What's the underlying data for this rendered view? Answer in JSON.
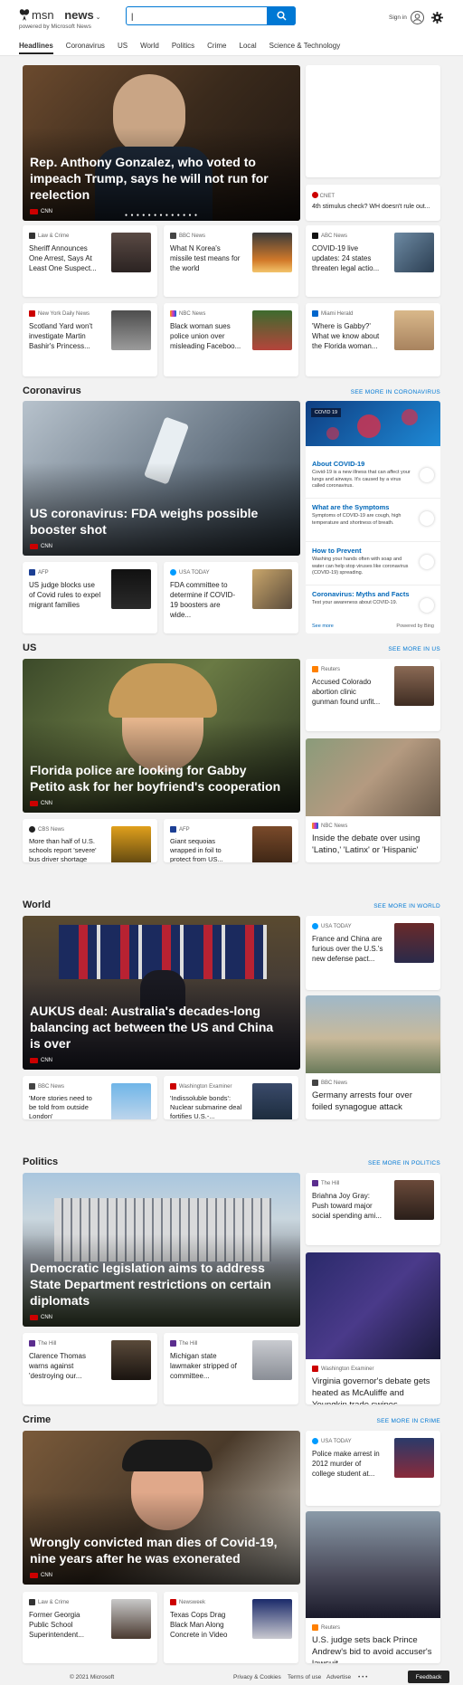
{
  "header": {
    "logo": "msn",
    "section": "news",
    "powered": "powered by Microsoft News",
    "search_value": "|",
    "signin": "Sign in"
  },
  "nav": [
    "Headlines",
    "Coronavirus",
    "US",
    "World",
    "Politics",
    "Crime",
    "Local",
    "Science & Technology"
  ],
  "top": {
    "hero": {
      "title": "Rep. Anthony Gonzalez, who voted to impeach Trump, says he will not run for reelection",
      "source": "CNN",
      "dots": "● ● ● ● ● ● ● ● ● ● ● ● ●"
    },
    "side": {
      "source": "CNET",
      "title": "4th stimulus check? WH doesn't rule out..."
    },
    "row1": [
      {
        "source": "Law & Crime",
        "title": "Sheriff Announces One Arrest, Says At Least One Suspect..."
      },
      {
        "source": "BBC News",
        "title": "What N Korea's missile test means for the world"
      },
      {
        "source": "ABC News",
        "title": "COVID-19 live updates: 24 states threaten legal actio..."
      }
    ],
    "row2": [
      {
        "source": "New York Daily News",
        "title": "Scotland Yard won't investigate Martin Bashir's Princess..."
      },
      {
        "source": "NBC News",
        "title": "Black woman sues police union over misleading Faceboo..."
      },
      {
        "source": "Miami Herald",
        "title": "'Where is Gabby?' What we know about the Florida woman..."
      }
    ]
  },
  "coronavirus": {
    "heading": "Coronavirus",
    "more": "SEE MORE IN CORONAVIRUS",
    "hero": {
      "title": "US coronavirus: FDA weighs possible booster shot",
      "source": "CNN"
    },
    "panel": {
      "badge": "COVID 19",
      "items": [
        {
          "title": "About COVID-19",
          "text": "Covid-19 is a new illness that can affect your lungs and airways. It's caused by a virus called coronavirus."
        },
        {
          "title": "What are the Symptoms",
          "text": "Symptoms of COVID-19 are cough, high temperature and shortness of breath."
        },
        {
          "title": "How to Prevent",
          "text": "Washing your hands often with soap and water can help stop viruses like coronavirus (COVID-19) spreading."
        },
        {
          "title": "Coronavirus: Myths and Facts",
          "text": "Test your awareness about COVID-19."
        }
      ],
      "see_more": "See more",
      "powered": "Powered by Bing"
    },
    "row": [
      {
        "source": "AFP",
        "title": "US judge blocks use of Covid rules to expel migrant families"
      },
      {
        "source": "USA TODAY",
        "title": "FDA committee to determine if COVID-19 boosters are wide..."
      }
    ]
  },
  "us": {
    "heading": "US",
    "more": "SEE MORE IN US",
    "hero": {
      "title": "Florida police are looking for Gabby Petito ask for her boyfriend's cooperation",
      "source": "CNN"
    },
    "side": {
      "source": "Reuters",
      "title": "Accused Colorado abortion clinic gunman found unfit..."
    },
    "big": {
      "source": "NBC News",
      "title": "Inside the debate over using 'Latino,' 'Latinx' or 'Hispanic'"
    },
    "row": [
      {
        "source": "CBS News",
        "title": "More than half of U.S. schools report 'severe' bus driver shortage"
      },
      {
        "source": "AFP",
        "title": "Giant sequoias wrapped in foil to protect from US..."
      }
    ]
  },
  "world": {
    "heading": "World",
    "more": "SEE MORE IN WORLD",
    "hero": {
      "title": "AUKUS deal: Australia's decades-long balancing act between the US and China is over",
      "source": "CNN"
    },
    "side": {
      "source": "USA TODAY",
      "title": "France and China are furious over the U.S.'s new defense pact..."
    },
    "big": {
      "source": "BBC News",
      "title": "Germany arrests four over foiled synagogue attack"
    },
    "row": [
      {
        "source": "BBC News",
        "title": "'More stories need to be told from outside London'"
      },
      {
        "source": "Washington Examiner",
        "title": "'Indissoluble bonds': Nuclear submarine deal fortifies U.S.-..."
      }
    ]
  },
  "politics": {
    "heading": "Politics",
    "more": "SEE MORE IN POLITICS",
    "hero": {
      "title": "Democratic legislation aims to address State Department restrictions on certain diplomats",
      "source": "CNN"
    },
    "side": {
      "source": "The Hill",
      "title": "Briahna Joy Gray: Push toward major social spending ami..."
    },
    "big": {
      "source": "Washington Examiner",
      "title": "Virginia governor's debate gets heated as McAuliffe and Youngkin trade swipes"
    },
    "row": [
      {
        "source": "The Hill",
        "title": "Clarence Thomas warns against 'destroying our..."
      },
      {
        "source": "The Hill",
        "title": "Michigan state lawmaker stripped of committee..."
      }
    ]
  },
  "crime": {
    "heading": "Crime",
    "more": "SEE MORE IN CRIME",
    "hero": {
      "title": "Wrongly convicted man dies of Covid-19, nine years after he was exonerated",
      "source": "CNN"
    },
    "side": {
      "source": "USA TODAY",
      "title": "Police make arrest in 2012 murder of college student at..."
    },
    "big": {
      "source": "Reuters",
      "title": "U.S. judge sets back Prince Andrew's bid to avoid accuser's lawsuit"
    },
    "row": [
      {
        "source": "Law & Crime",
        "title": "Former Georgia Public School Superintendent..."
      },
      {
        "source": "Newsweek",
        "title": "Texas Cops Drag Black Man Along Concrete in Video"
      }
    ]
  },
  "footer": {
    "copyright": "© 2021 Microsoft",
    "privacy": "Privacy & Cookies",
    "terms": "Terms of use",
    "advertise": "Advertise",
    "more": "• • •",
    "feedback": "Feedback"
  }
}
